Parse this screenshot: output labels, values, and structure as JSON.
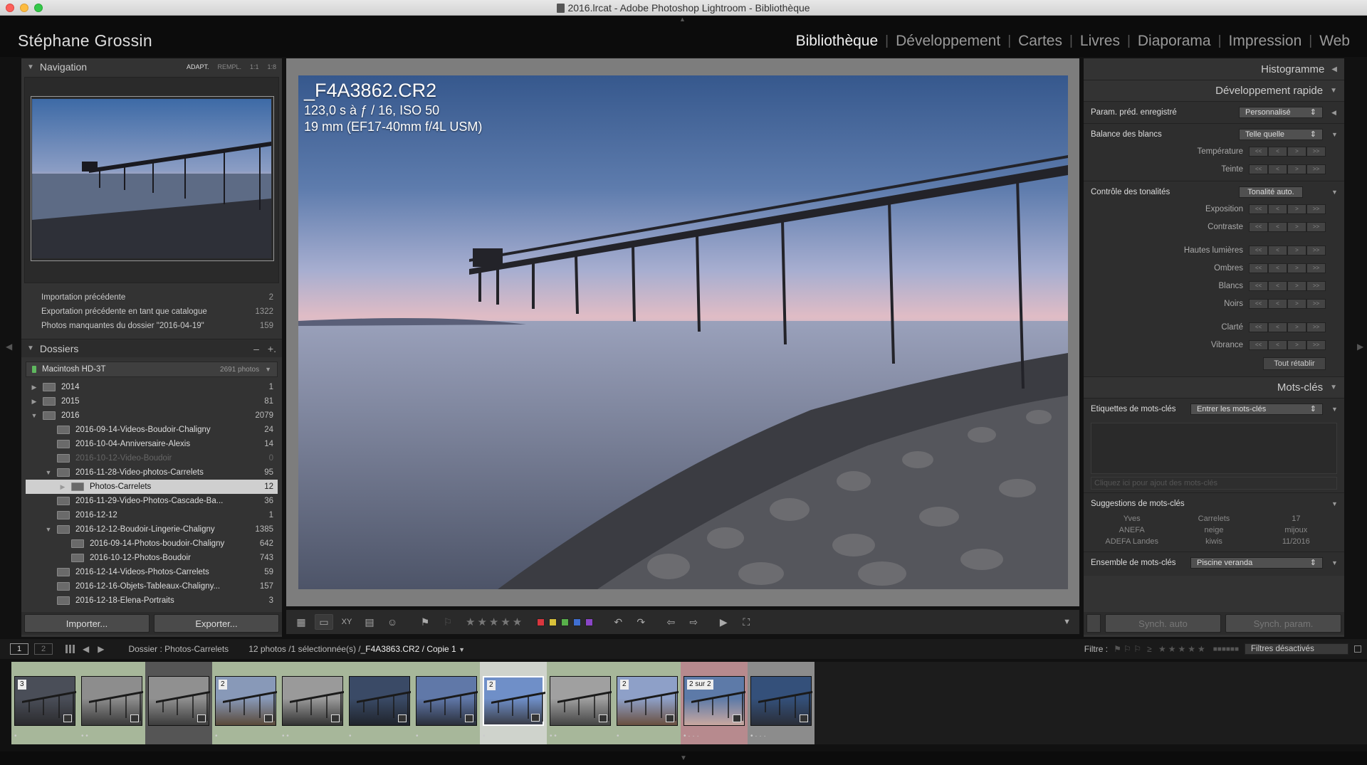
{
  "window": {
    "title": "2016.lrcat - Adobe Photoshop Lightroom - Bibliothèque"
  },
  "identity_plate": "Stéphane Grossin",
  "modules": [
    {
      "label": "Bibliothèque",
      "active": true
    },
    {
      "label": "Développement",
      "active": false
    },
    {
      "label": "Cartes",
      "active": false
    },
    {
      "label": "Livres",
      "active": false
    },
    {
      "label": "Diaporama",
      "active": false
    },
    {
      "label": "Impression",
      "active": false
    },
    {
      "label": "Web",
      "active": false
    }
  ],
  "navigator": {
    "title": "Navigation",
    "options": [
      "ADAPT.",
      "REMPL.",
      "1:1",
      "1:8"
    ]
  },
  "catalog": [
    {
      "label": "Importation précédente",
      "count": "2"
    },
    {
      "label": "Exportation précédente en tant que catalogue",
      "count": "1322"
    },
    {
      "label": "Photos manquantes du dossier \"2016-04-19\"",
      "count": "159"
    }
  ],
  "folders_panel": {
    "title": "Dossiers",
    "controls": [
      "–",
      "+."
    ],
    "volume": {
      "name": "Macintosh HD-3T",
      "count": "2691 photos"
    },
    "items": [
      {
        "name": "2014",
        "count": "1",
        "level": 0,
        "expand": "▶"
      },
      {
        "name": "2015",
        "count": "81",
        "level": 0,
        "expand": "▶"
      },
      {
        "name": "2016",
        "count": "2079",
        "level": 0,
        "expand": "▼"
      },
      {
        "name": "2016-09-14-Videos-Boudoir-Chaligny",
        "count": "24",
        "level": 1,
        "expand": ""
      },
      {
        "name": "2016-10-04-Anniversaire-Alexis",
        "count": "14",
        "level": 1,
        "expand": ""
      },
      {
        "name": "2016-10-12-Video-Boudoir",
        "count": "0",
        "level": 1,
        "expand": "",
        "dim": true
      },
      {
        "name": "2016-11-28-Video-photos-Carrelets",
        "count": "95",
        "level": 1,
        "expand": "▼"
      },
      {
        "name": "Photos-Carrelets",
        "count": "12",
        "level": 2,
        "expand": "▶",
        "selected": true
      },
      {
        "name": "2016-11-29-Video-Photos-Cascade-Ba...",
        "count": "36",
        "level": 1,
        "expand": ""
      },
      {
        "name": "2016-12-12",
        "count": "1",
        "level": 1,
        "expand": ""
      },
      {
        "name": "2016-12-12-Boudoir-Lingerie-Chaligny",
        "count": "1385",
        "level": 1,
        "expand": "▼"
      },
      {
        "name": "2016-09-14-Photos-boudoir-Chaligny",
        "count": "642",
        "level": 2,
        "expand": ""
      },
      {
        "name": "2016-10-12-Photos-Boudoir",
        "count": "743",
        "level": 2,
        "expand": ""
      },
      {
        "name": "2016-12-14-Videos-Photos-Carrelets",
        "count": "59",
        "level": 1,
        "expand": ""
      },
      {
        "name": "2016-12-16-Objets-Tableaux-Chaligny...",
        "count": "157",
        "level": 1,
        "expand": ""
      },
      {
        "name": "2016-12-18-Elena-Portraits",
        "count": "3",
        "level": 1,
        "expand": ""
      }
    ]
  },
  "left_buttons": {
    "import": "Importer...",
    "export": "Exporter..."
  },
  "photo": {
    "filename": "_F4A3862.CR2",
    "exposure": "123,0 s à ƒ / 16, ISO 50",
    "lens": "19 mm (EF17-40mm f/4L USM)"
  },
  "toolbar": {
    "stars": "★★★★★",
    "labels": [
      "#d9363e",
      "#d8c13a",
      "#58b04a",
      "#3f6fd1",
      "#8a46c7"
    ]
  },
  "right_panel": {
    "histogram": "Histogramme",
    "quick_develop": "Développement rapide",
    "preset_label": "Param. préd. enregistré",
    "preset_value": "Personnalisé",
    "wb_label": "Balance des blancs",
    "wb_value": "Telle quelle",
    "wb_controls": [
      "Température",
      "Teinte"
    ],
    "tone_label": "Contrôle des tonalités",
    "tone_button": "Tonalité auto.",
    "tone_controls_1": [
      "Exposition",
      "Contraste"
    ],
    "tone_controls_2": [
      "Hautes lumières",
      "Ombres",
      "Blancs",
      "Noirs"
    ],
    "tone_controls_3": [
      "Clarté",
      "Vibrance"
    ],
    "reset": "Tout rétablir",
    "keywords_title": "Mots-clés",
    "kw_tags_label": "Etiquettes de mots-clés",
    "kw_tags_value": "Entrer les mots-clés",
    "kw_input_placeholder": "Cliquez ici pour ajout des mots-clés",
    "kw_suggestions_label": "Suggestions de mots-clés",
    "kw_suggestions": [
      "Yves",
      "Carrelets",
      "17",
      "ANEFA",
      "neige",
      "mijoux",
      "ADEFA Landes",
      "kiwis",
      "11/2016"
    ],
    "kw_set_label": "Ensemble de mots-clés",
    "kw_set_value": "Piscine veranda",
    "sync_auto": "Synch. auto",
    "sync_params": "Synch. param."
  },
  "filmstrip_bar": {
    "screen1": "1",
    "screen2": "2",
    "source": "Dossier : Photos-Carrelets",
    "info": "12 photos /1 sélectionnée(s) /",
    "current": "_F4A3863.CR2 / Copie 1",
    "filter_label": "Filtre :",
    "filter_value": "Filtres désactivés"
  },
  "filmstrip": [
    {
      "stack": "3",
      "bg": "#a7b79a",
      "stars": "•"
    },
    {
      "stack": "",
      "bg": "#a7b79a",
      "stars": "• •"
    },
    {
      "stack": "",
      "bg": "#555",
      "stars": ""
    },
    {
      "stack": "2",
      "bg": "#a7b79a",
      "stars": "•"
    },
    {
      "stack": "",
      "bg": "#a7b79a",
      "stars": "• •"
    },
    {
      "stack": "",
      "bg": "#a7b79a",
      "stars": "•"
    },
    {
      "stack": "",
      "bg": "#a7b79a",
      "stars": "•"
    },
    {
      "stack": "2",
      "bg": "#cfd3cc",
      "stars": "•",
      "selected": true
    },
    {
      "stack": "",
      "bg": "#a7b79a",
      "stars": "• •"
    },
    {
      "stack": "2",
      "bg": "#a7b79a",
      "stars": "•"
    },
    {
      "stack": "2 sur 2",
      "bg": "#b78a8e",
      "stars": "• · · ·"
    },
    {
      "stack": "",
      "bg": "#8c8c8c",
      "stars": "• · · ·"
    }
  ]
}
